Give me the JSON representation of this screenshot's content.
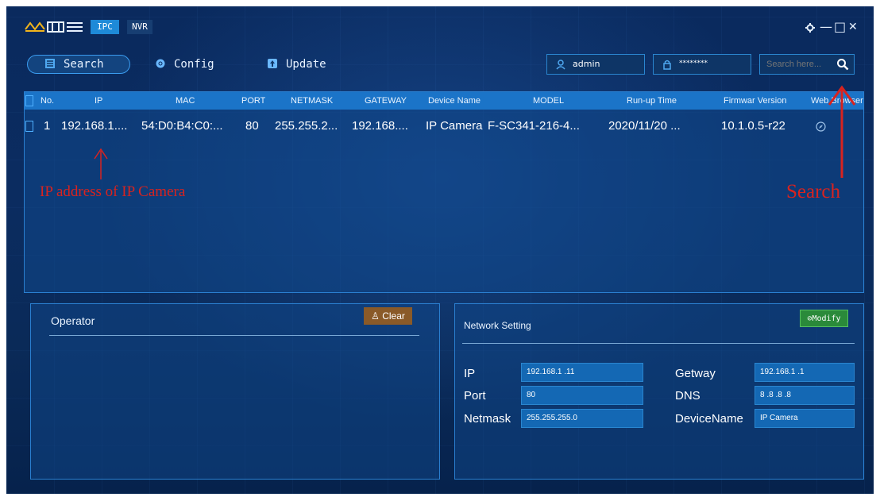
{
  "titlebar": {
    "mode_ipc": "IPC",
    "mode_nvr": "NVR",
    "settings_icon": "gear-icon",
    "minimize_glyph": "—",
    "maximize_glyph": "□",
    "close_glyph": "✕"
  },
  "nav": {
    "search": "Search",
    "config": "Config",
    "update": "Update"
  },
  "login": {
    "username": "admin",
    "password": "********",
    "search_placeholder": "Search here..."
  },
  "table": {
    "headers": [
      "No.",
      "IP",
      "MAC",
      "PORT",
      "NETMASK",
      "GATEWAY",
      "Device Name",
      "MODEL",
      "Run-up Time",
      "Firmwar Version",
      "Web Browser"
    ],
    "rows": [
      {
        "no": "1",
        "ip": "192.168.1....",
        "mac": "54:D0:B4:C0:...",
        "port": "80",
        "netmask": "255.255.2...",
        "gateway": "192.168....",
        "device_name": "IP Camera",
        "model": "F-SC341-216-4...",
        "runup": "2020/11/20 ...",
        "firmware": "10.1.0.5-r22",
        "web_icon": "compass-icon"
      }
    ]
  },
  "annotations": {
    "ip_label": "IP address of IP Camera",
    "search_label": "Search",
    "color": "#d8231f"
  },
  "operator": {
    "title": "Operator",
    "clear": "Clear"
  },
  "network": {
    "title": "Network Setting",
    "modify": "Modify",
    "ip_label": "IP",
    "ip_value": "192.168.1 .11",
    "port_label": "Port",
    "port_value": "80",
    "netmask_label": "Netmask",
    "netmask_value": "255.255.255.0",
    "gateway_label": "Getway",
    "gateway_value": "192.168.1 .1",
    "dns_label": "DNS",
    "dns_value": "8 .8 .8 .8",
    "devicename_label": "DeviceName",
    "devicename_value": "IP Camera"
  },
  "colors": {
    "background": "#0a2a5e",
    "accent": "#1e8ad8",
    "header": "#1b74c8",
    "clear_button": "#8a5a28",
    "modify_button": "#2a8a3a"
  }
}
